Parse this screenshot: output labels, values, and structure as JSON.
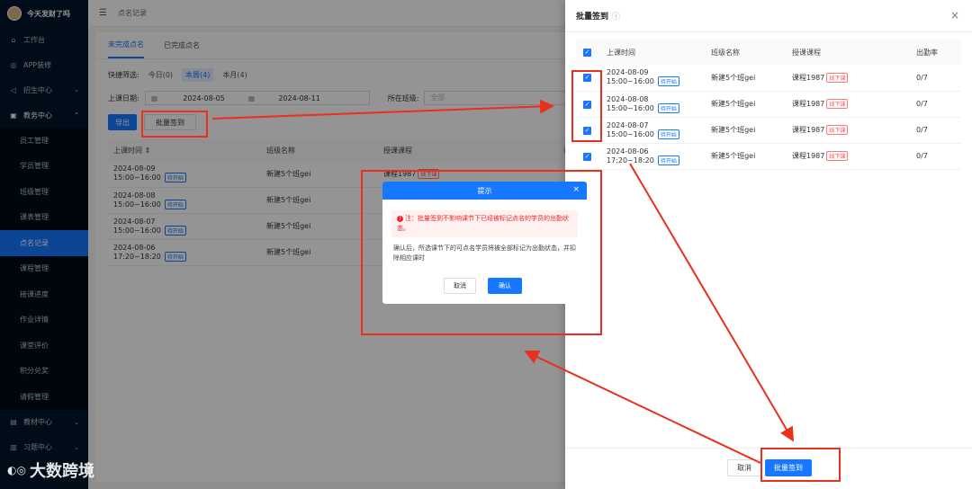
{
  "sidebar": {
    "brand": "今天发财了吗",
    "items": [
      {
        "label": "工作台",
        "icon": "home-icon"
      },
      {
        "label": "APP装修",
        "icon": "app-icon"
      },
      {
        "label": "招生中心",
        "icon": "send-icon"
      },
      {
        "label": "教务中心",
        "icon": "book-icon"
      }
    ],
    "sub_items": [
      "员工管理",
      "学员管理",
      "班级管理",
      "课表管理",
      "点名记录",
      "课程管理",
      "接课进度",
      "作业详情",
      "课堂评价",
      "积分兑奖",
      "请假管理"
    ],
    "items_after": [
      {
        "label": "教材中心",
        "icon": "material-icon"
      },
      {
        "label": "习题中心",
        "icon": "exercise-icon"
      }
    ]
  },
  "topbar": {
    "breadcrumb": "点名记录"
  },
  "tabs": [
    "未完成点名",
    "已完成点名"
  ],
  "filters": {
    "quick_label": "快捷筛选:",
    "quick_options": [
      "今日(0)",
      "本周(4)",
      "本月(4)"
    ],
    "date_label": "上课日期:",
    "date_start": "2024-08-05",
    "date_end": "2024-08-11",
    "class_label": "所在班级:",
    "class_placeholder": "全部"
  },
  "actions": {
    "export": "导出",
    "batch": "批量签到"
  },
  "table": {
    "headers": [
      "上课时间 ⇕",
      "班级名称",
      "授课课程",
      "课"
    ],
    "rows": [
      {
        "date": "2024-08-09",
        "time": "15:00~16:00",
        "status": "待开始",
        "class": "新建5个班gei",
        "course": "课程1987",
        "tag": "线下课"
      },
      {
        "date": "2024-08-08",
        "time": "15:00~16:00",
        "status": "待开始",
        "class": "新建5个班gei",
        "course": "",
        "tag": ""
      },
      {
        "date": "2024-08-07",
        "time": "15:00~16:00",
        "status": "待开始",
        "class": "新建5个班gei",
        "course": "",
        "tag": ""
      },
      {
        "date": "2024-08-06",
        "time": "17:20~18:20",
        "status": "待开始",
        "class": "新建5个班gei",
        "course": "",
        "tag": ""
      }
    ]
  },
  "drawer": {
    "title": "批量签到",
    "headers": [
      "上课时间",
      "班级名称",
      "授课课程",
      "出勤率"
    ],
    "rows": [
      {
        "date": "2024-08-09",
        "time": "15:00~16:00",
        "status": "待开始",
        "class": "新建5个班gei",
        "course": "课程1987",
        "tag": "线下课",
        "rate": "0/7"
      },
      {
        "date": "2024-08-08",
        "time": "15:00~16:00",
        "status": "待开始",
        "class": "新建5个班gei",
        "course": "课程1987",
        "tag": "线下课",
        "rate": "0/7"
      },
      {
        "date": "2024-08-07",
        "time": "15:00~16:00",
        "status": "待开始",
        "class": "新建5个班gei",
        "course": "课程1987",
        "tag": "线下课",
        "rate": "0/7"
      },
      {
        "date": "2024-08-06",
        "time": "17:20~18:20",
        "status": "待开始",
        "class": "新建5个班gei",
        "course": "课程1987",
        "tag": "线下课",
        "rate": "0/7"
      }
    ],
    "cancel": "取消",
    "confirm": "批量签到"
  },
  "dialog": {
    "title": "提示",
    "warning": "注：批量签到不影响课节下已经被标记点名的学员的出勤状态。",
    "body": "确认后，所选课节下的可点名学员将被全部标记为出勤状态，并扣除相应课时",
    "cancel": "取消",
    "confirm": "确认"
  },
  "watermark": "大数跨境",
  "colors": {
    "primary": "#1677ff",
    "sidebar": "#001529",
    "annotation": "#e8301c"
  }
}
